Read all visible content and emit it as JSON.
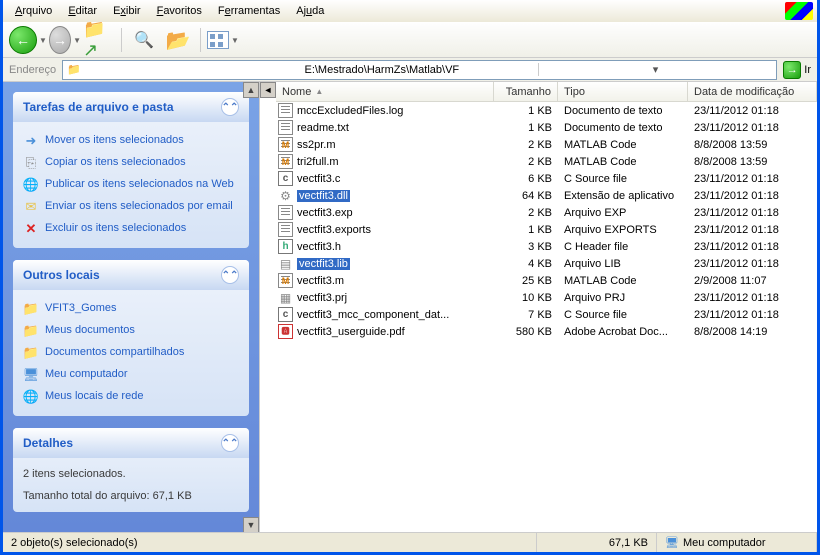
{
  "menu": {
    "arquivo": "Arquivo",
    "editar": "Editar",
    "exibir": "Exibir",
    "favoritos": "Favoritos",
    "ferramentas": "Ferramentas",
    "ajuda": "Ajuda"
  },
  "address": {
    "label": "Endereço",
    "path": "E:\\Mestrado\\HarmZs\\Matlab\\VF",
    "go": "Ir"
  },
  "panels": {
    "tasks": {
      "title": "Tarefas de arquivo e pasta",
      "items": [
        "Mover os itens selecionados",
        "Copiar os itens selecionados",
        "Publicar os itens selecionados na Web",
        "Enviar os itens selecionados por email",
        "Excluir os itens selecionados"
      ]
    },
    "places": {
      "title": "Outros locais",
      "items": [
        "VFIT3_Gomes",
        "Meus documentos",
        "Documentos compartilhados",
        "Meu computador",
        "Meus locais de rede"
      ]
    },
    "details": {
      "title": "Detalhes",
      "line1": "2 itens selecionados.",
      "line2": "Tamanho total do arquivo: 67,1 KB"
    }
  },
  "columns": {
    "name": "Nome",
    "size": "Tamanho",
    "type": "Tipo",
    "date": "Data de modificação"
  },
  "files": [
    {
      "icon": "txt",
      "name": "mccExcludedFiles.log",
      "size": "1 KB",
      "type": "Documento de texto",
      "date": "23/11/2012 01:18",
      "sel": false
    },
    {
      "icon": "txt",
      "name": "readme.txt",
      "size": "1 KB",
      "type": "Documento de texto",
      "date": "23/11/2012 01:18",
      "sel": false
    },
    {
      "icon": "m",
      "name": "ss2pr.m",
      "size": "2 KB",
      "type": "MATLAB Code",
      "date": "8/8/2008 13:59",
      "sel": false
    },
    {
      "icon": "m",
      "name": "tri2full.m",
      "size": "2 KB",
      "type": "MATLAB Code",
      "date": "8/8/2008 13:59",
      "sel": false
    },
    {
      "icon": "c",
      "name": "vectfit3.c",
      "size": "6 KB",
      "type": "C Source file",
      "date": "23/11/2012 01:18",
      "sel": false
    },
    {
      "icon": "gear",
      "name": "vectfit3.dll",
      "size": "64 KB",
      "type": "Extensão de aplicativo",
      "date": "23/11/2012 01:18",
      "sel": true
    },
    {
      "icon": "txt",
      "name": "vectfit3.exp",
      "size": "2 KB",
      "type": "Arquivo EXP",
      "date": "23/11/2012 01:18",
      "sel": false
    },
    {
      "icon": "txt",
      "name": "vectfit3.exports",
      "size": "1 KB",
      "type": "Arquivo EXPORTS",
      "date": "23/11/2012 01:18",
      "sel": false
    },
    {
      "icon": "h",
      "name": "vectfit3.h",
      "size": "3 KB",
      "type": "C Header file",
      "date": "23/11/2012 01:18",
      "sel": false
    },
    {
      "icon": "lib",
      "name": "vectfit3.lib",
      "size": "4 KB",
      "type": "Arquivo LIB",
      "date": "23/11/2012 01:18",
      "sel": true
    },
    {
      "icon": "m",
      "name": "vectfit3.m",
      "size": "25 KB",
      "type": "MATLAB Code",
      "date": "2/9/2008 11:07",
      "sel": false
    },
    {
      "icon": "prj",
      "name": "vectfit3.prj",
      "size": "10 KB",
      "type": "Arquivo PRJ",
      "date": "23/11/2012 01:18",
      "sel": false
    },
    {
      "icon": "c",
      "name": "vectfit3_mcc_component_dat...",
      "size": "7 KB",
      "type": "C Source file",
      "date": "23/11/2012 01:18",
      "sel": false
    },
    {
      "icon": "pdf",
      "name": "vectfit3_userguide.pdf",
      "size": "580 KB",
      "type": "Adobe Acrobat Doc...",
      "date": "8/8/2008 14:19",
      "sel": false
    }
  ],
  "status": {
    "selection": "2 objeto(s) selecionado(s)",
    "size": "67,1 KB",
    "location": "Meu computador"
  }
}
